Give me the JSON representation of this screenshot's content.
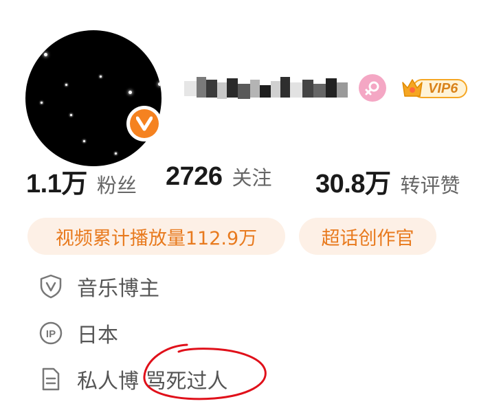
{
  "profile": {
    "avatar_icon": "starry-night-avatar",
    "verified_icon": "orange-v-verified-icon",
    "gender_icon": "female-icon",
    "vip_label": "VIP6",
    "vip_icon": "crown-icon"
  },
  "stats": [
    {
      "value": "1.1万",
      "label": "粉丝"
    },
    {
      "value": "2726",
      "label": "关注"
    },
    {
      "value": "30.8万",
      "label": "转评赞"
    }
  ],
  "tags": [
    {
      "label": "视频累计播放量112.9万"
    },
    {
      "label": "超话创作官"
    }
  ],
  "info": {
    "category": {
      "icon": "shield-v-icon",
      "text": "音乐博主"
    },
    "ip": {
      "icon": "ip-icon",
      "text": "日本"
    },
    "bio": {
      "icon": "document-icon",
      "text": "私人博 骂死过人"
    }
  },
  "colors": {
    "accent_orange": "#f58220",
    "tag_bg": "#fdf0e6",
    "tag_text": "#e87a1e",
    "gender_pink": "#f4a7c4",
    "vip_gold": "#f5a623",
    "annotation_red": "#e0101a"
  }
}
